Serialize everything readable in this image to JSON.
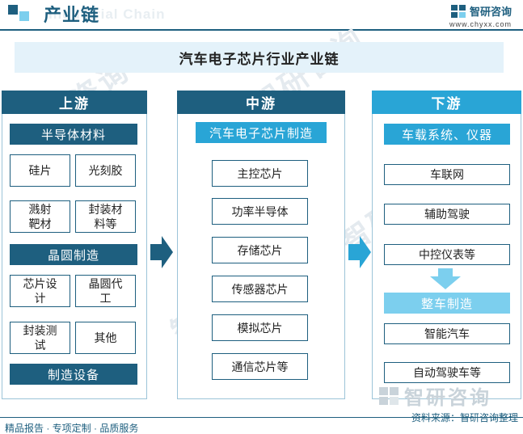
{
  "header": {
    "title": "产业链",
    "watermark_english": "Industrial Chain",
    "brand_name": "智研咨询",
    "brand_url": "www.chyxx.com"
  },
  "watermark_text": "智研咨询",
  "diagram": {
    "title": "汽车电子芯片行业产业链",
    "upstream": {
      "head": "上游",
      "sections": [
        {
          "label": "半导体材料",
          "items": [
            "硅片",
            "光刻胶",
            "溅射靶材",
            "封装材料等"
          ]
        },
        {
          "label": "晶圆制造",
          "items": [
            "芯片设计",
            "晶圆代工",
            "封装测试",
            "其他"
          ]
        },
        {
          "label": "制造设备",
          "items": []
        }
      ]
    },
    "midstream": {
      "head": "中游",
      "label": "汽车电子芯片制造",
      "items": [
        "主控芯片",
        "功率半导体",
        "存储芯片",
        "传感器芯片",
        "模拟芯片",
        "通信芯片等"
      ]
    },
    "downstream": {
      "head": "下游",
      "label1": "车载系统、仪器",
      "items1": [
        "车联网",
        "辅助驾驶",
        "中控仪表等"
      ],
      "label2": "整车制造",
      "items2": [
        "智能汽车",
        "自动驾驶车等"
      ]
    }
  },
  "footer": {
    "left": "精品报告 · 专项定制 · 品质服务",
    "source": "资料来源：智研咨询整理"
  },
  "colors": {
    "dark": "#1e5f7f",
    "cyan": "#29a5d6",
    "light": "#7ccfee",
    "banner": "#e4f2fa"
  }
}
